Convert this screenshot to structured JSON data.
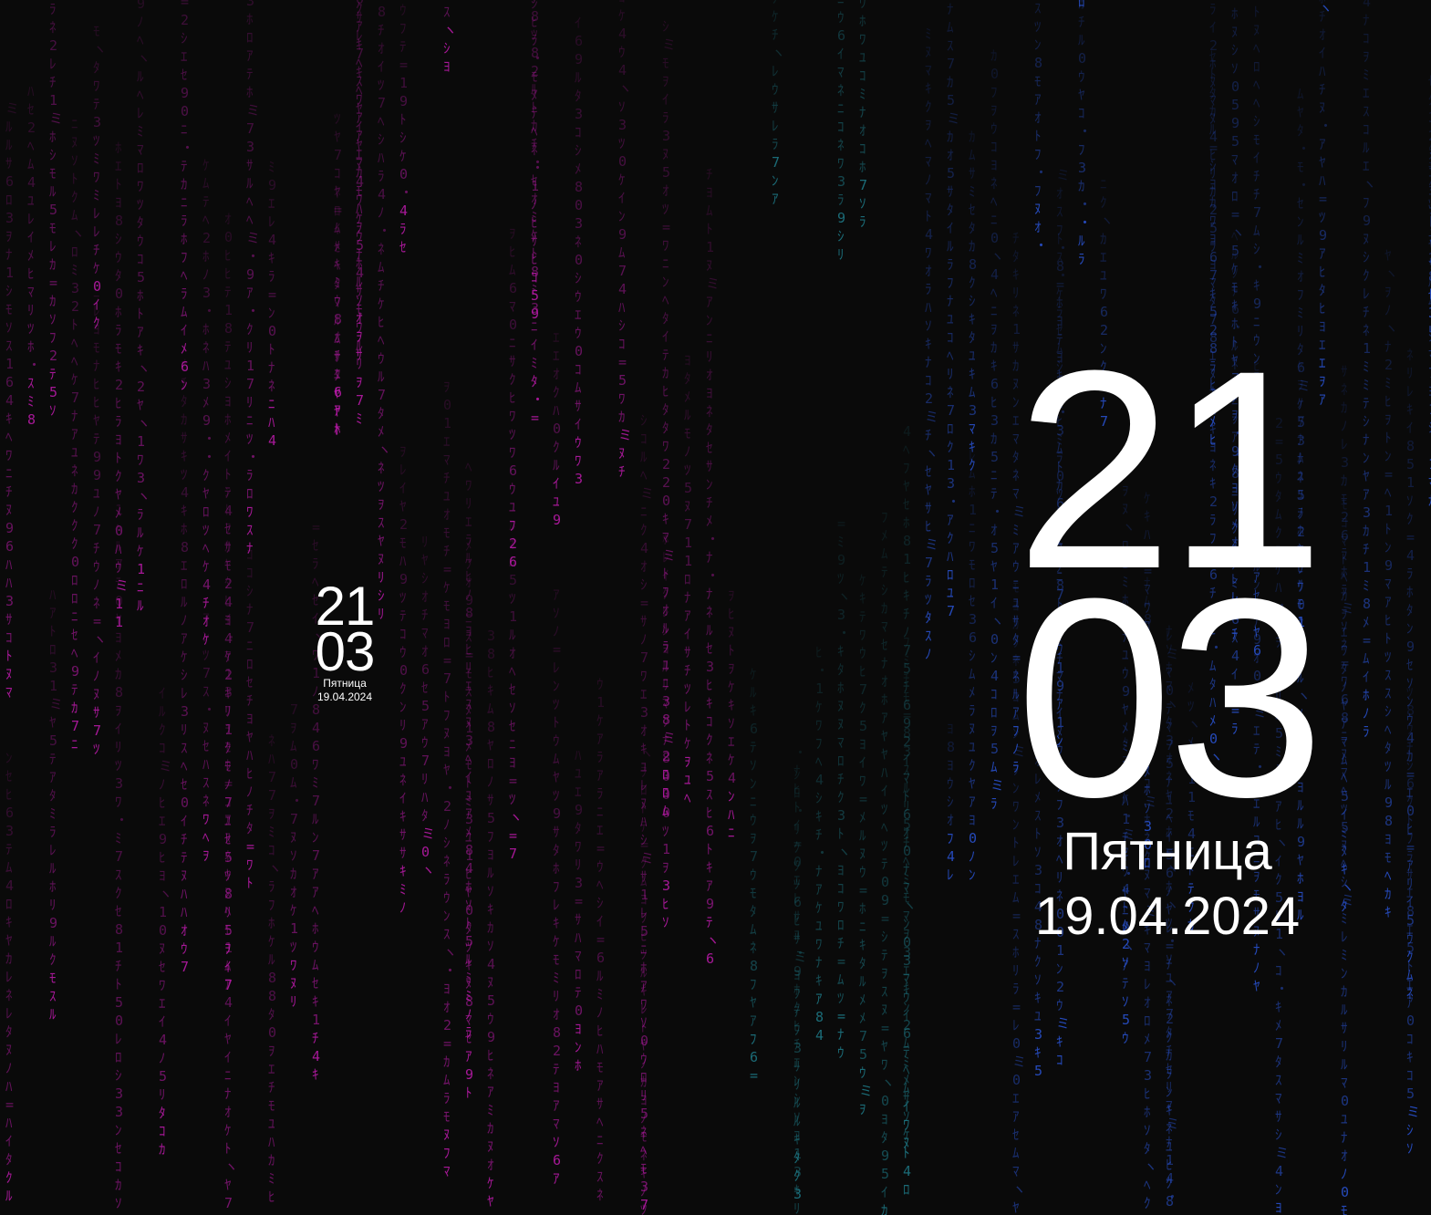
{
  "background": {
    "color": "#0a0a0a",
    "rain_colors": [
      "#c21bb0",
      "#2a55d8",
      "#1e7d8a"
    ],
    "rain_glyphs": "ｱｲｳｴｵｶｷｸｹｺｻｼｽｾｿﾀﾁﾂﾃﾄﾅﾆﾇﾈﾉﾊﾋﾌﾍﾎﾏﾐﾑﾒﾓﾔﾕﾖﾗﾘﾙﾚﾛﾜｦﾝ0123456789=・ヽミ"
  },
  "clock_large": {
    "hours": "21",
    "minutes": "03",
    "weekday": "Пятница",
    "date": "19.04.2024"
  },
  "clock_small": {
    "hours": "21",
    "minutes": "03",
    "weekday": "Пятница",
    "date": "19.04.2024"
  }
}
